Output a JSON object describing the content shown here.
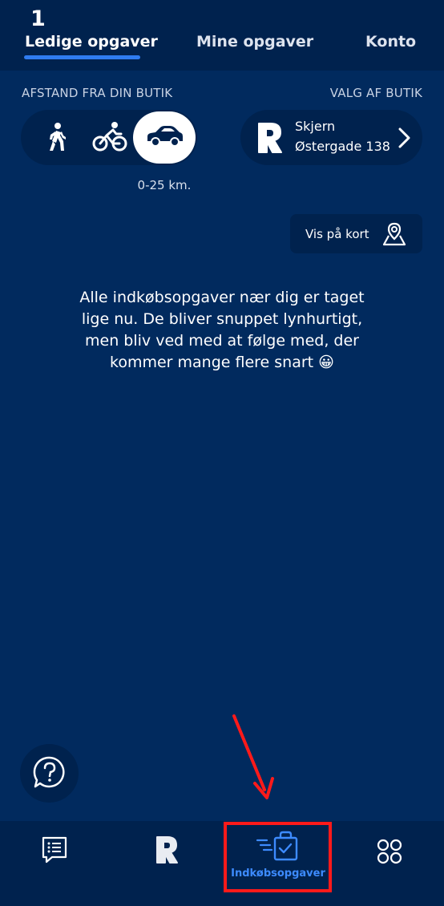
{
  "header": {
    "tab_count": "1",
    "tabs": [
      {
        "label": "Ledige opgaver",
        "active": true
      },
      {
        "label": "Mine opgaver",
        "active": false
      },
      {
        "label": "Konto",
        "active": false
      }
    ]
  },
  "filters": {
    "distance_label": "AFSTAND FRA DIN BUTIK",
    "store_label": "VALG AF BUTIK",
    "modes": [
      {
        "icon": "walk-icon",
        "selected": false
      },
      {
        "icon": "bike-icon",
        "selected": false
      },
      {
        "icon": "car-icon",
        "selected": true
      }
    ],
    "distance_range": "0-25 km."
  },
  "store": {
    "logo_icon": "rema-r-logo",
    "city": "Skjern",
    "street": "Østergade 138"
  },
  "map_button": {
    "label": "Vis på kort",
    "icon": "map-pin-icon"
  },
  "empty_state": {
    "message": "Alle indkøbsopgaver nær dig er taget lige nu. De bliver snuppet lynhurtigt, men bliv ved med at følge med, der kommer mange flere snart 😀"
  },
  "bottom_nav": {
    "items": [
      {
        "icon": "list-chat-icon",
        "active": false
      },
      {
        "icon": "rema-r-icon",
        "active": false
      },
      {
        "icon": "shopping-bag-check-icon",
        "label": "Indkøbsopgaver",
        "active": true
      },
      {
        "icon": "grid-dots-icon",
        "active": false
      }
    ]
  },
  "colors": {
    "background": "#012a5e",
    "surface": "#00224e",
    "accent": "#2f7cf0",
    "annotation": "#ff1a1a"
  }
}
